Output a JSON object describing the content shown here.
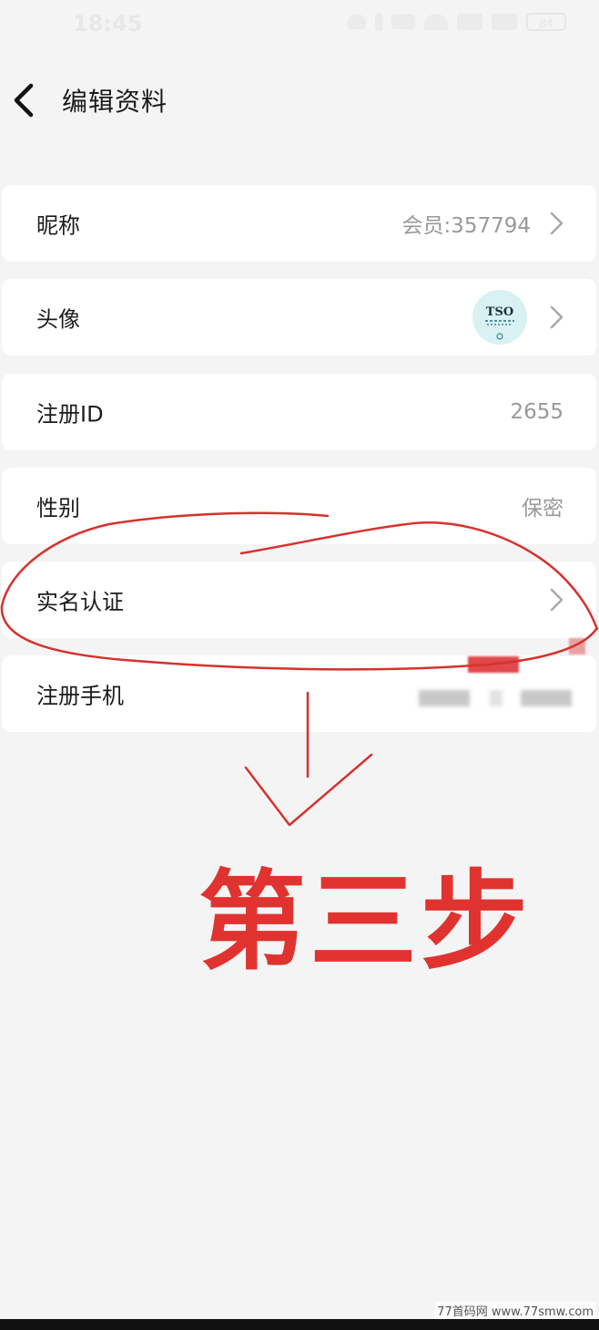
{
  "status_bar": {
    "time": "18:45",
    "battery": "84"
  },
  "header": {
    "title": "编辑资料",
    "back_icon": "chevron-left-icon"
  },
  "profile_items": [
    {
      "label": "昵称",
      "value": "会员:357794",
      "has_arrow": true
    },
    {
      "label": "头像",
      "value": "",
      "avatar_text": "TSO",
      "has_arrow": true
    },
    {
      "label": "注册ID",
      "value": "2655",
      "has_arrow": false
    },
    {
      "label": "性别",
      "value": "保密",
      "has_arrow": false
    },
    {
      "label": "实名认证",
      "value": "",
      "has_arrow": true
    },
    {
      "label": "注册手机",
      "value": "",
      "has_arrow": false
    }
  ],
  "annotation": {
    "text": "第三步",
    "color": "#e0332f"
  },
  "watermark": "77首码网 www.77smw.com"
}
